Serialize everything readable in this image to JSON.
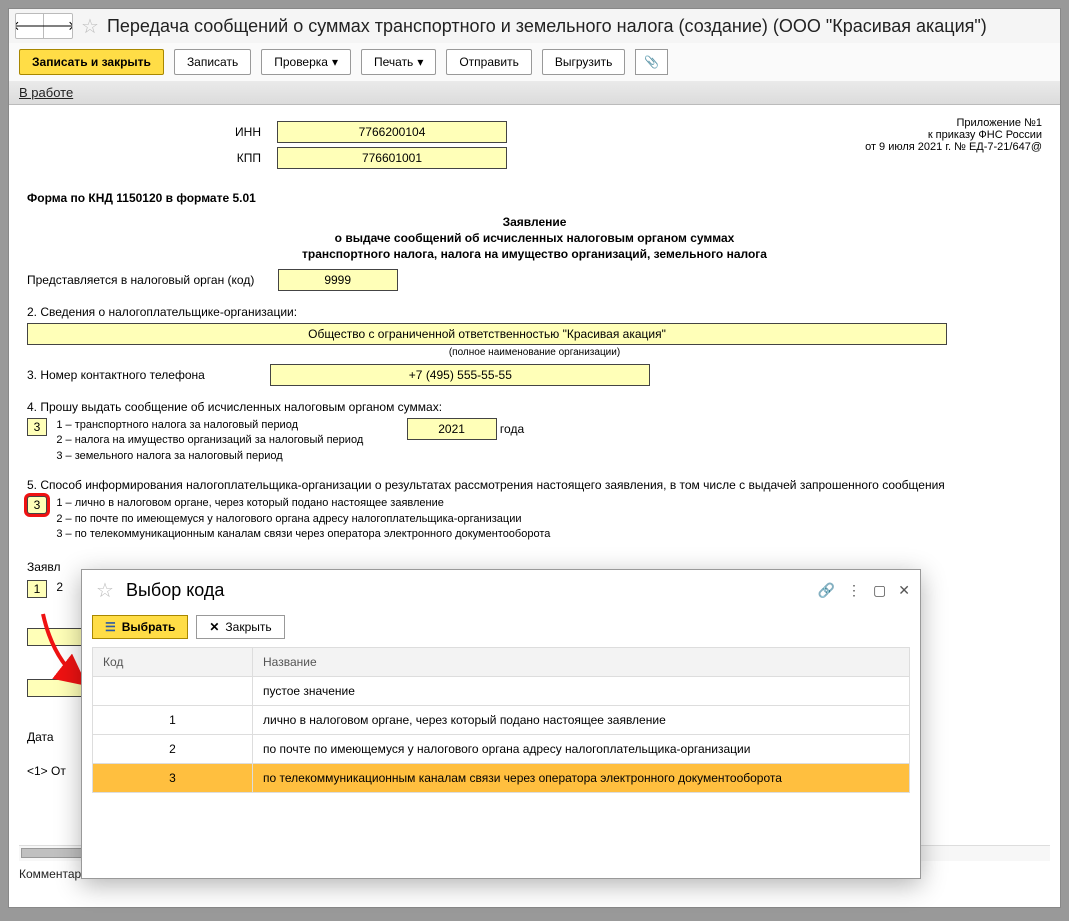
{
  "title": "Передача сообщений о суммах транспортного и земельного налога (создание) (ООО \"Красивая акация\")",
  "toolbar": {
    "save_close": "Записать и закрыть",
    "save": "Записать",
    "check": "Проверка",
    "print": "Печать",
    "send": "Отправить",
    "export": "Выгрузить"
  },
  "tab": "В работе",
  "doc": {
    "inn_label": "ИНН",
    "inn": "7766200104",
    "kpp_label": "КПП",
    "kpp": "776601001",
    "app_lines": {
      "l1": "Приложение №1",
      "l2": "к приказу ФНС России",
      "l3": "от 9 июля 2021 г. № ЕД-7-21/647@"
    },
    "formcode": "Форма по КНД 1150120 в формате 5.01",
    "heading1": "Заявление",
    "heading2": "о выдаче сообщений об исчисленных налоговым органом суммах",
    "heading3": "транспортного налога, налога на имущество организаций, земельного налога",
    "authority_label": "Представляется в налоговый орган (код)",
    "authority": "9999",
    "sec2_label": "2. Сведения о налогоплательщике-организации:",
    "org_name": "Общество с ограниченной ответственностью \"Красивая акация\"",
    "org_hint": "(полное наименование организации)",
    "sec3_label": "3. Номер контактного телефона",
    "phone": "+7 (495) 555-55-55",
    "sec4_label": "4. Прошу выдать сообщение об исчисленных налоговым органом суммах:",
    "sec4_value": "3",
    "sec4_opts": {
      "o1": "1 – транспортного налога за налоговый период",
      "o2": "2 – налога на имущество организаций за налоговый период",
      "o3": "3 – земельного налога за налоговый период"
    },
    "year": "2021",
    "year_suffix": "года",
    "sec5_label": "5. Способ информирования налогоплательщика-организации о результатах рассмотрения настоящего заявления, в том числе с выдачей запрошенного сообщения",
    "sec5_value": "3",
    "sec5_opts": {
      "o1": "1 – лично в налоговом органе, через который подано настоящее заявление",
      "o2": "2 – по почте по имеющемуся у налогового органа адресу налогоплательщика-организации",
      "o3": "3 – по телекоммуникационным каналам связи через оператора электронного документооборота"
    },
    "partial1": "Заявл",
    "partial_num": "1",
    "partial_date": "Дата",
    "partial_ref": "<1> От",
    "comments": "Комментарии:"
  },
  "dialog": {
    "title": "Выбор кода",
    "select_btn": "Выбрать",
    "close_btn": "Закрыть",
    "th_code": "Код",
    "th_name": "Название",
    "rows": [
      {
        "code": "",
        "name": "пустое значение"
      },
      {
        "code": "1",
        "name": "лично в налоговом органе, через который подано настоящее заявление"
      },
      {
        "code": "2",
        "name": "по почте по имеющемуся у налогового органа адресу налогоплательщика-организации"
      },
      {
        "code": "3",
        "name": "по телекоммуникационным каналам связи через оператора электронного документооборота"
      }
    ]
  }
}
